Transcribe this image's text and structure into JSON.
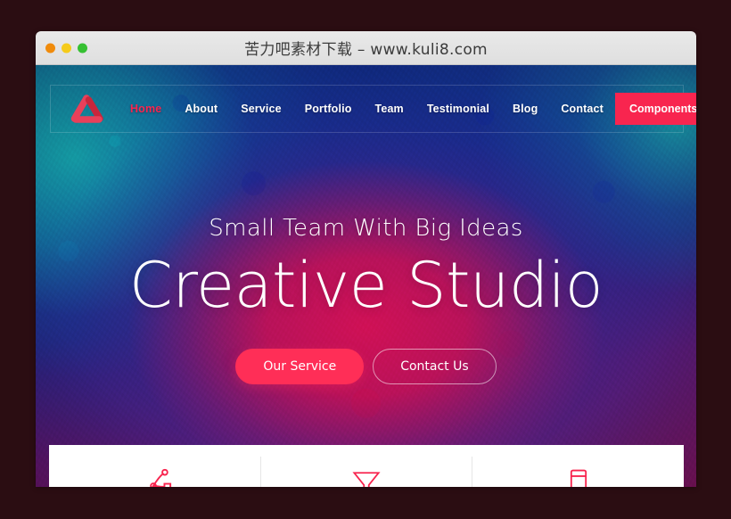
{
  "window": {
    "title": "苦力吧素材下载 – www.kuli8.com",
    "traffic_lights": [
      {
        "name": "close",
        "color": "#f08b0c"
      },
      {
        "name": "minimize",
        "color": "#f5cb1b"
      },
      {
        "name": "zoom",
        "color": "#36c032"
      }
    ]
  },
  "site": {
    "logo_name": "creative-studio-logo",
    "accent": "#f8254f",
    "accent_button": "#ff2e57",
    "page_background": "#2b0d12"
  },
  "nav": {
    "items": [
      {
        "label": "Home",
        "active": true
      },
      {
        "label": "About",
        "active": false
      },
      {
        "label": "Service",
        "active": false
      },
      {
        "label": "Portfolio",
        "active": false
      },
      {
        "label": "Team",
        "active": false
      },
      {
        "label": "Testimonial",
        "active": false
      },
      {
        "label": "Blog",
        "active": false
      },
      {
        "label": "Contact",
        "active": false
      }
    ],
    "cta_label": "Components"
  },
  "hero": {
    "subtitle": "Small Team With Big Ideas",
    "title": "Creative Studio",
    "primary_button": "Our Service",
    "secondary_button": "Contact Us"
  },
  "features": {
    "items": [
      {
        "icon": "bezier-path-icon",
        "color": "#f8254f"
      },
      {
        "icon": "funnel-filter-icon",
        "color": "#f8254f"
      },
      {
        "icon": "mobile-phone-icon",
        "color": "#f8254f"
      }
    ]
  }
}
